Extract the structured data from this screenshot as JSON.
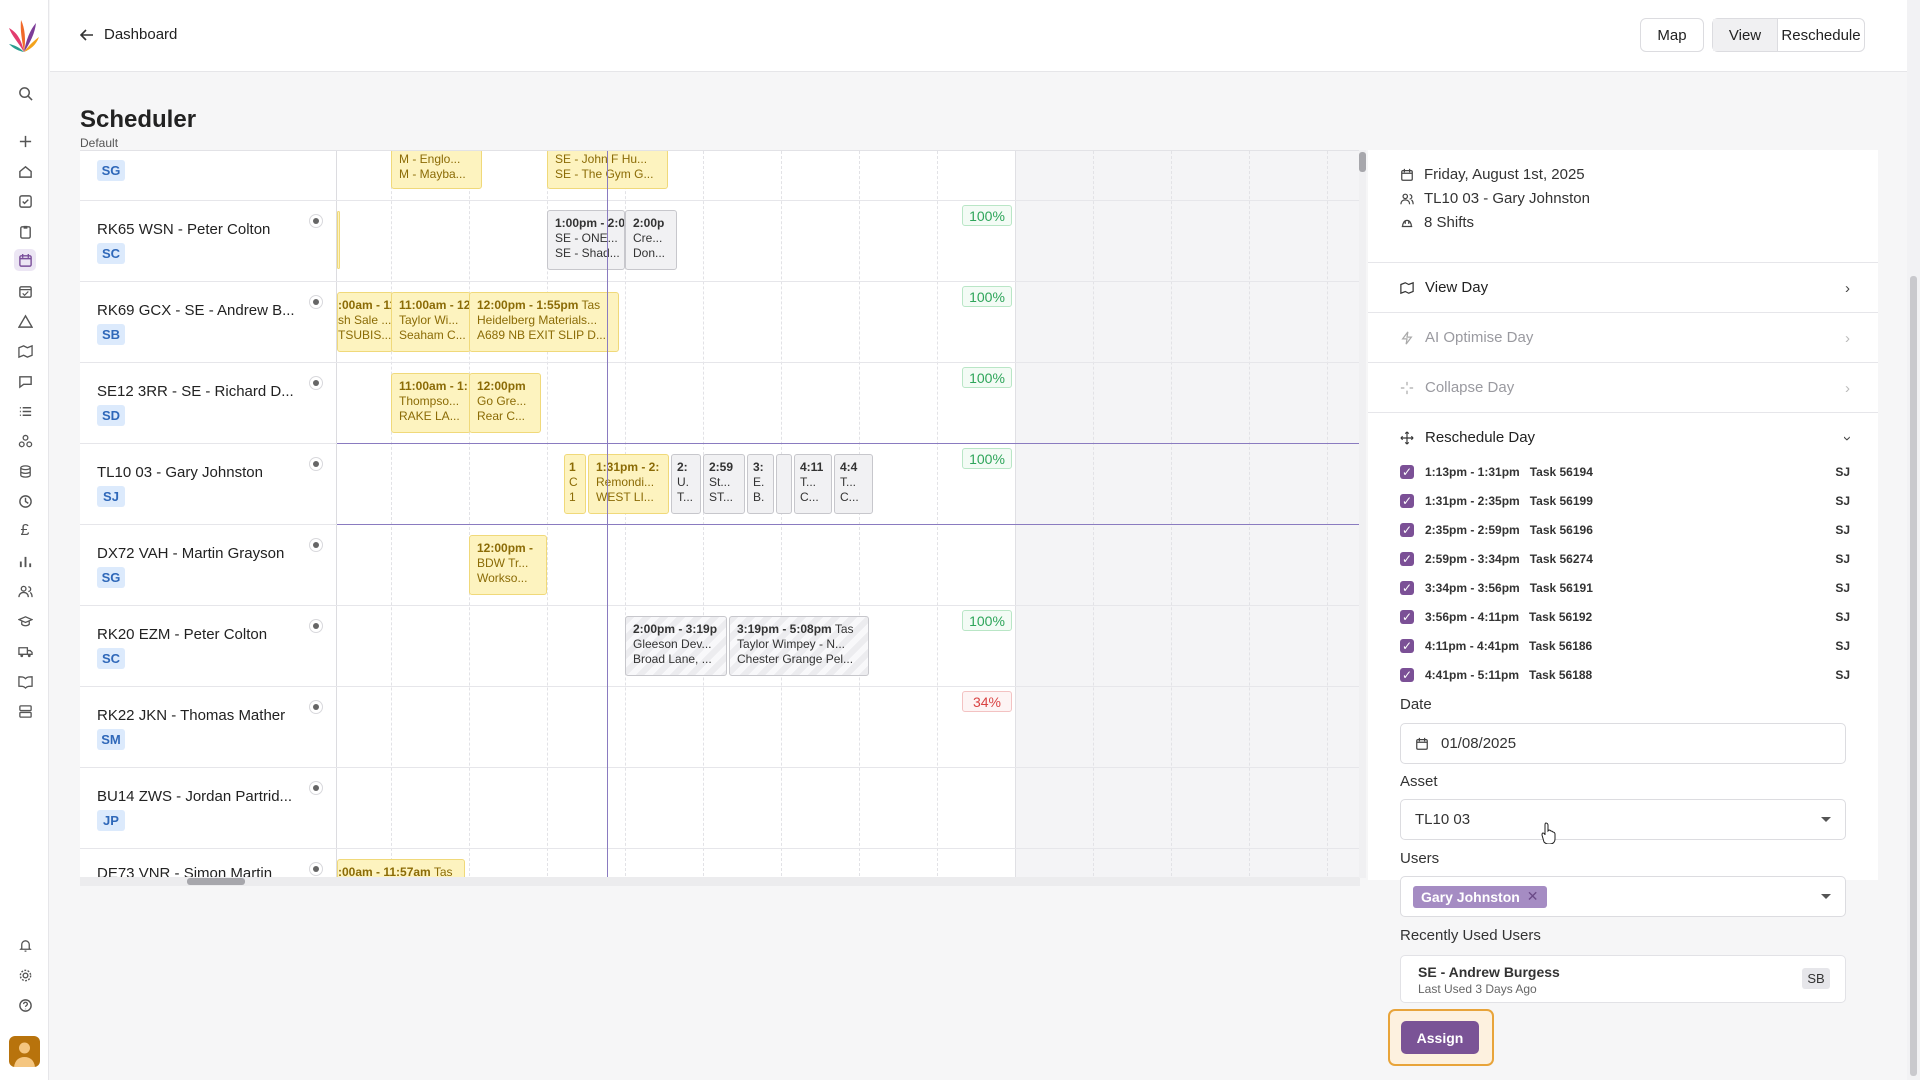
{
  "topbar": {
    "back_label": "Dashboard",
    "map_label": "Map",
    "view_label": "View",
    "reschedule_label": "Reschedule"
  },
  "page": {
    "title": "Scheduler",
    "subtitle": "Default"
  },
  "rows": [
    {
      "name": "",
      "badge": "SG"
    },
    {
      "name": "RK65 WSN - Peter Colton",
      "badge": "SC",
      "pct": "100%"
    },
    {
      "name": "RK69 GCX - SE - Andrew B...",
      "badge": "SB",
      "pct": "100%"
    },
    {
      "name": "SE12 3RR - SE - Richard D...",
      "badge": "SD",
      "pct": "100%"
    },
    {
      "name": "TL10 03 - Gary Johnston",
      "badge": "SJ",
      "pct": "100%"
    },
    {
      "name": "DX72 VAH - Martin Grayson",
      "badge": "SG"
    },
    {
      "name": "RK20 EZM - Peter Colton",
      "badge": "SC",
      "pct": "100%"
    },
    {
      "name": "RK22 JKN - Thomas Mather",
      "badge": "SM",
      "pct": "34%"
    },
    {
      "name": "BU14 ZWS - Jordan Partrid...",
      "badge": "JP"
    },
    {
      "name": "DE73 VNR - Simon Martin",
      "badge": ""
    }
  ],
  "tasks": {
    "t0a": {
      "l1": "M - Englo...",
      "l2": "M - Mayba..."
    },
    "t0b": {
      "l1": "SE - John F Hu...",
      "l2": "SE - The Gym G..."
    },
    "t1a": {
      "l1": "1:00pm - 2:0",
      "l2": "SE - ONE...",
      "l3": "SE - Shad..."
    },
    "t1b": {
      "l1": "2:00p",
      "l2": "Cre...",
      "l3": "Don..."
    },
    "t2a": {
      "l1": ":00am - 11",
      "l2": "sh Sale ...",
      "l3": "TSUBIS..."
    },
    "t2b": {
      "l1": "11:00am - 12",
      "l2": "Taylor Wi...",
      "l3": "Seaham C..."
    },
    "t2c": {
      "l1": "12:00pm - 1:55pm",
      "l1b": "Tas",
      "l2": "Heidelberg Materials...",
      "l3": "A689 NB EXIT SLIP D..."
    },
    "t3a": {
      "l1": "11:00am - 1:",
      "l2": "Thompso...",
      "l3": "RAKE LA..."
    },
    "t3b": {
      "l1": "12:00pm",
      "l2": "Go Gre...",
      "l3": "Rear C..."
    },
    "t4a": {
      "l1": "1",
      "l2": "C",
      "l3": "1"
    },
    "t4b": {
      "l1": "1:31pm - 2:",
      "l2": "Remondi...",
      "l3": "WEST LI..."
    },
    "t4c": {
      "l1": "2:",
      "l2": "U.",
      "l3": "T..."
    },
    "t4d": {
      "l1": "2:59",
      "l2": "St...",
      "l3": "ST..."
    },
    "t4e": {
      "l1": "3:",
      "l2": "E.",
      "l3": "B."
    },
    "t4g": {
      "l1": "4:11",
      "l2": "T...",
      "l3": "C..."
    },
    "t4h": {
      "l1": "4:4",
      "l2": "T...",
      "l3": "C..."
    },
    "t5a": {
      "l1": "12:00pm -",
      "l2": "BDW Tr...",
      "l3": "Workso..."
    },
    "t6a": {
      "l1": "2:00pm - 3:19p",
      "l2": "Gleeson Dev...",
      "l3": "Broad Lane, ..."
    },
    "t6b": {
      "l1": "3:19pm - 5:08pm",
      "l1b": "Tas",
      "l2": "Taylor Wimpey - N...",
      "l3": "Chester Grange Pel..."
    },
    "t9a": {
      "l1": ":00am - 11:57am",
      "l1b": "Tas"
    }
  },
  "panel": {
    "date_line": "Friday, August 1st, 2025",
    "asset_line": "TL10 03 - Gary Johnston",
    "shifts_line": "8 Shifts",
    "actions": [
      "View Day",
      "AI Optimise Day",
      "Collapse Day",
      "Reschedule Day"
    ],
    "task_items": [
      {
        "time": "1:13pm - 1:31pm",
        "task": "Task 56194",
        "initials": "SJ"
      },
      {
        "time": "1:31pm - 2:35pm",
        "task": "Task 56199",
        "initials": "SJ"
      },
      {
        "time": "2:35pm - 2:59pm",
        "task": "Task 56196",
        "initials": "SJ"
      },
      {
        "time": "2:59pm - 3:34pm",
        "task": "Task 56274",
        "initials": "SJ"
      },
      {
        "time": "3:34pm - 3:56pm",
        "task": "Task 56191",
        "initials": "SJ"
      },
      {
        "time": "3:56pm - 4:11pm",
        "task": "Task 56192",
        "initials": "SJ"
      },
      {
        "time": "4:11pm - 4:41pm",
        "task": "Task 56186",
        "initials": "SJ"
      },
      {
        "time": "4:41pm - 5:11pm",
        "task": "Task 56188",
        "initials": "SJ"
      }
    ],
    "date_label": "Date",
    "date_value": "01/08/2025",
    "asset_label": "Asset",
    "asset_value": "TL10 03",
    "users_label": "Users",
    "user_chip": "Gary Johnston",
    "recent_label": "Recently Used Users",
    "recent_name": "SE - Andrew Burgess",
    "recent_sub": "Last Used 3 Days Ago",
    "recent_initials": "SB",
    "assign_label": "Assign"
  }
}
